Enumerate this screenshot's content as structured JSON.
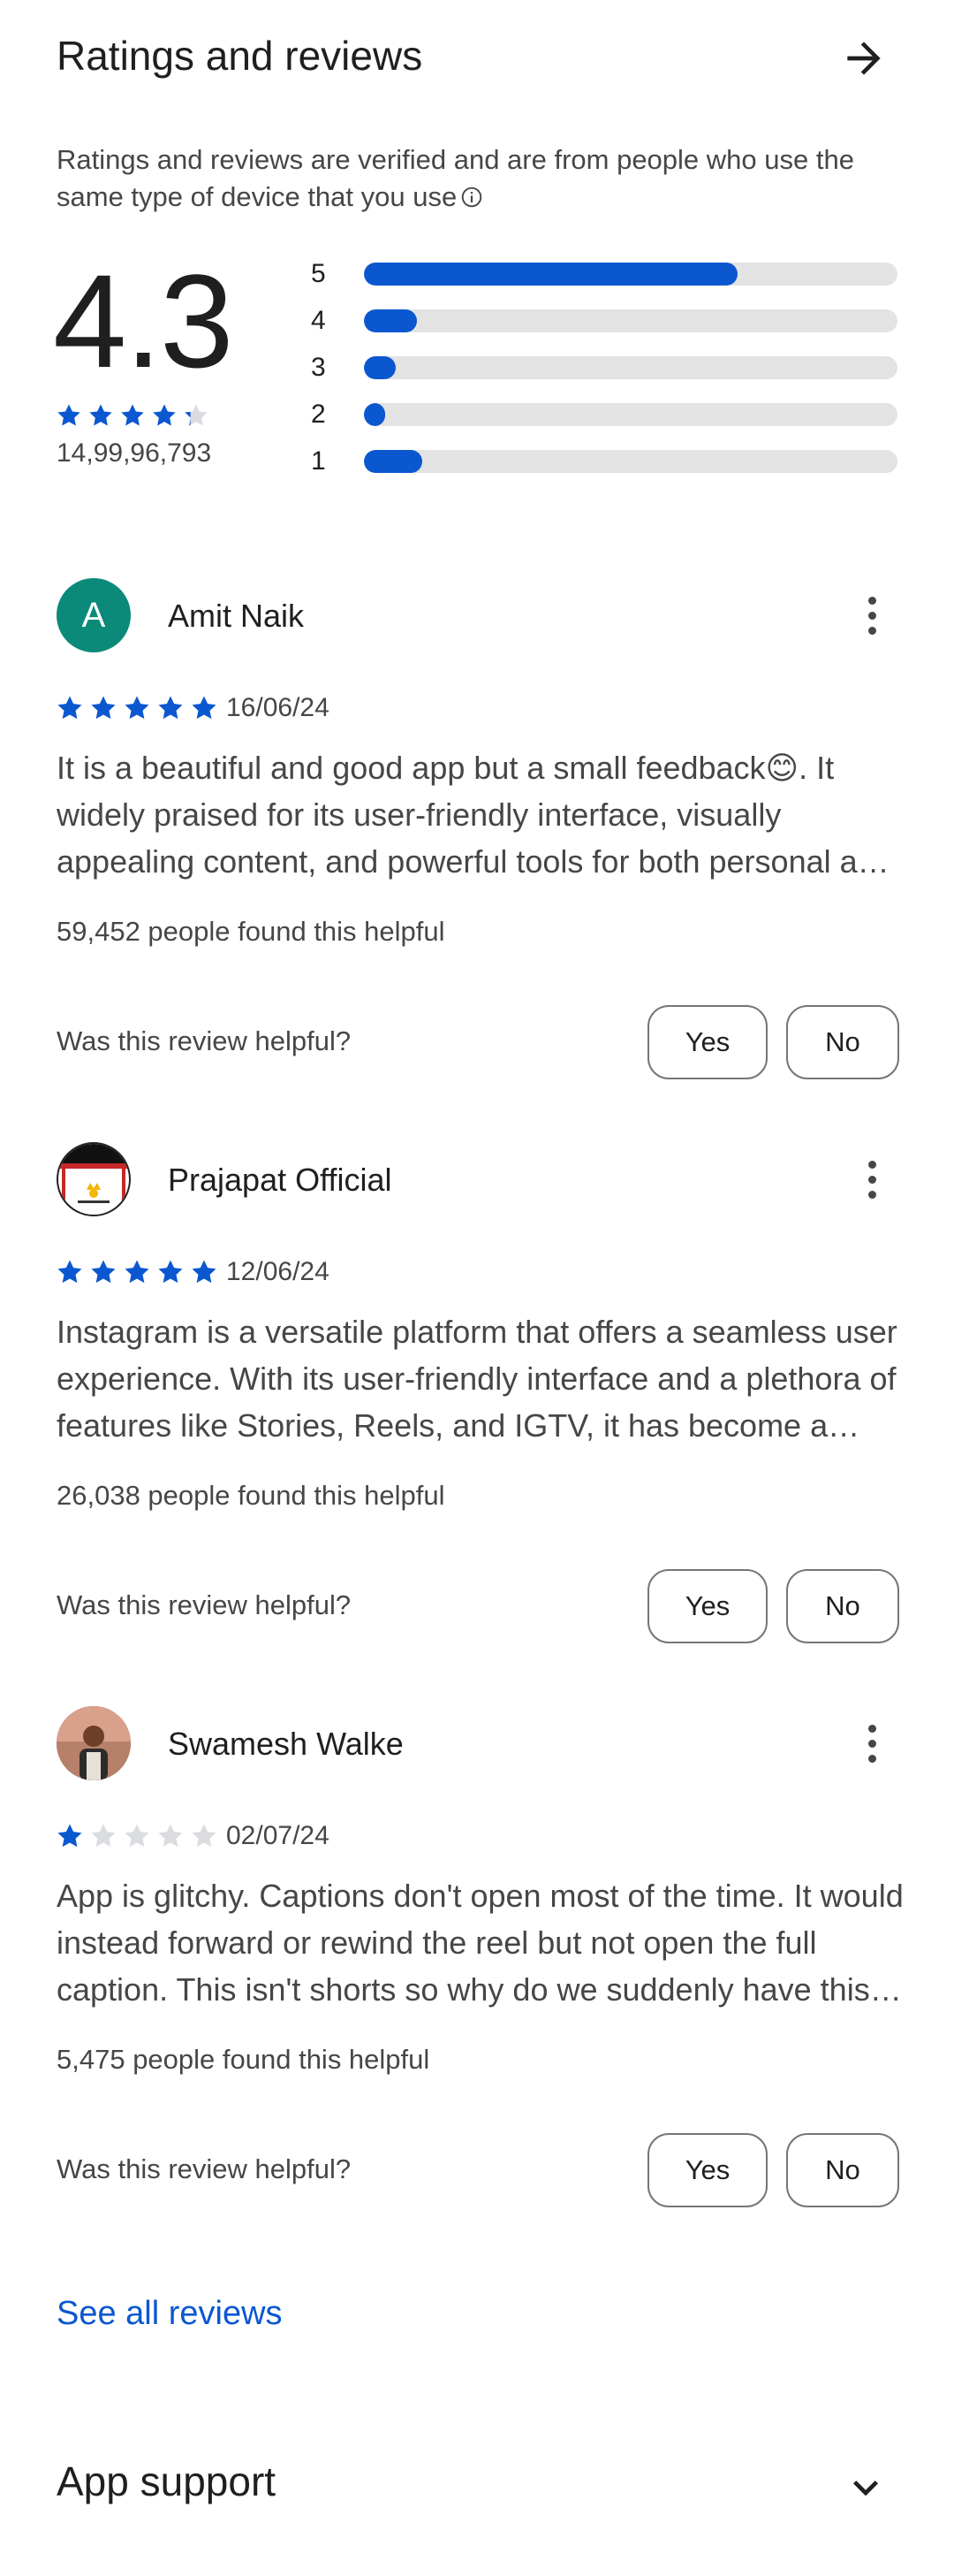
{
  "header": {
    "title": "Ratings and reviews",
    "arrow_icon": "arrow-right-icon"
  },
  "verification": {
    "text": "Ratings and reviews are verified and are from people who use the same type of device that you use",
    "info_icon": "info-icon"
  },
  "summary": {
    "rating": "4.3",
    "stars": 4.3,
    "total": "14,99,96,793",
    "distribution": [
      {
        "label": "5",
        "fraction": 0.7
      },
      {
        "label": "4",
        "fraction": 0.1
      },
      {
        "label": "3",
        "fraction": 0.06
      },
      {
        "label": "2",
        "fraction": 0.04
      },
      {
        "label": "1",
        "fraction": 0.11
      }
    ]
  },
  "reviews": [
    {
      "avatar_letter": "A",
      "name": "Amit Naik",
      "stars": 5,
      "date": "16/06/24",
      "text": "It is a beautiful and good app but a small feedback😊. It widely praised for its user-friendly interface, visually appealing content, and powerful tools for both personal and business use.",
      "helpful": "59,452 people found this helpful",
      "helpful_q": "Was this review helpful?",
      "yes": "Yes",
      "no": "No"
    },
    {
      "avatar_letter": "",
      "name": "Prajapat Official",
      "stars": 5,
      "date": "12/06/24",
      "text": "Instagram is a versatile platform that offers a seamless user experience. With its user-friendly interface and a plethora of features like Stories, Reels, and IGTV, it has become a favourite.",
      "helpful": "26,038 people found this helpful",
      "helpful_q": "Was this review helpful?",
      "yes": "Yes",
      "no": "No"
    },
    {
      "avatar_letter": "",
      "name": "Swamesh Walke",
      "stars": 1,
      "date": "02/07/24",
      "text": "App is glitchy. Captions don't open most of the time. It would instead forward or rewind the reel but not open the full caption. This isn't shorts so why do we suddenly have this problem?",
      "helpful": "5,475 people found this helpful",
      "helpful_q": "Was this review helpful?",
      "yes": "Yes",
      "no": "No"
    }
  ],
  "see_all": "See all reviews",
  "app_support": {
    "title": "App support",
    "chevron_icon": "chevron-down-icon"
  },
  "colors": {
    "accent": "#0b57d0",
    "track": "#e3e3e3",
    "star_empty": "#dadce0",
    "avatar_a": "#0b8a7a"
  }
}
